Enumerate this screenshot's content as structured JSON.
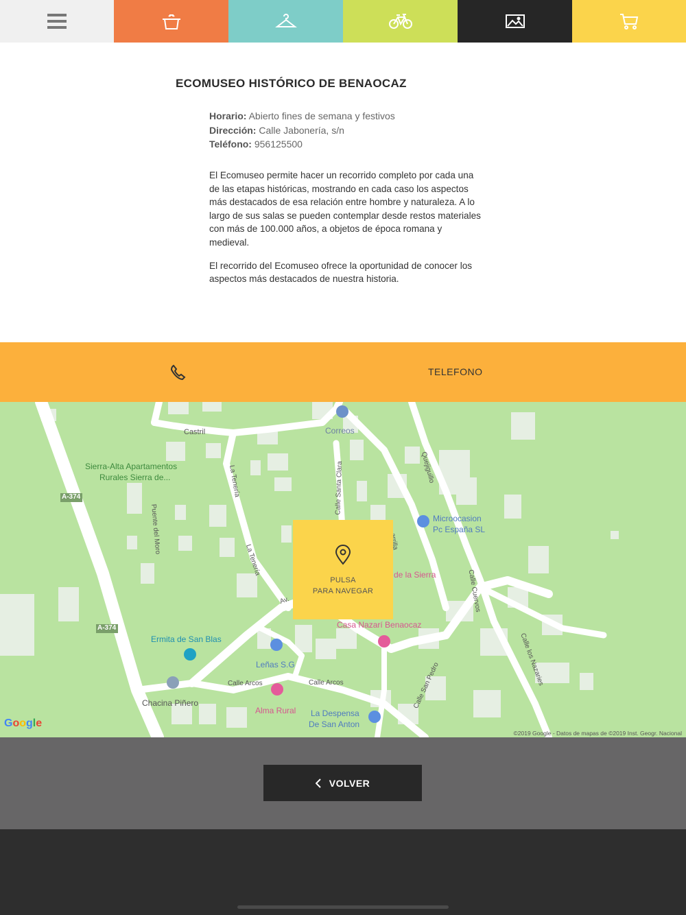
{
  "tabs": [
    {
      "name": "menu-icon",
      "color": "#f0f0f0"
    },
    {
      "name": "cooking-pot-icon",
      "color": "#f07c45"
    },
    {
      "name": "hanger-icon",
      "color": "#7ecdc8"
    },
    {
      "name": "bicycle-icon",
      "color": "#cddf58"
    },
    {
      "name": "image-icon",
      "color": "#262626"
    },
    {
      "name": "cart-icon",
      "color": "#fbd44b"
    }
  ],
  "place": {
    "title": "ECOMUSEO HISTÓRICO DE BENAOCAZ",
    "horario_label": "Horario:",
    "horario": "Abierto fines de semana y festivos",
    "direccion_label": "Dirección:",
    "direccion": "Calle Jabonería, s/n",
    "telefono_label": "Teléfono:",
    "telefono": "956125500",
    "description": [
      "El Ecomuseo permite hacer un recorrido completo por cada una de las etapas históricas, mostrando en cada caso los aspectos más destacados de esa relación entre hombre y naturaleza. A lo largo de sus salas se pueden contemplar desde restos materiales con más de 100.000 años, a objetos de época romana y medieval.",
      "El recorrido del Ecomuseo ofrece la oportunidad de conocer los aspectos más destacados de nuestra historia."
    ]
  },
  "phone_bar": {
    "icon": "phone-icon",
    "label": "TELEFONO",
    "color": "#fcb03c"
  },
  "map": {
    "labels": {
      "castril": "Castril",
      "correos": "Correos",
      "sierra_alta_1": "Sierra-Alta Apartamentos",
      "sierra_alta_2": "Rurales Sierra de...",
      "a374_1": "A-374",
      "a374_2": "A-374",
      "la_teneria_1": "La Tenería",
      "la_teneria_2": "La Tenería",
      "puente_moro": "Puente del Moro",
      "calle_santa_clara": "Calle Santa Clara",
      "quejiguillo": "Quejiguillo",
      "microocasion_1": "Microocasion",
      "microocasion_2": "Pc España SL",
      "de_la_sierra": "de la Sierra",
      "calle_cuervos": "Calle Cuervos",
      "barrilla": "arrilla",
      "casa_nazari": "Casa Nazarí Benaocaz",
      "calle_nazaries": "Calle los Nazaries",
      "av": "Av.",
      "ermita": "Ermita de San Blas",
      "lenas": "Leñas S.G",
      "calle_arcos_1": "Calle Arcos",
      "calle_arcos_2": "Calle Arcos",
      "calle_san_pedro": "Calle San Pedro",
      "chacina": "Chacina Piñero",
      "alma_rural": "Alma Rural",
      "despensa_1": "La Despensa",
      "despensa_2": "De San Anton"
    },
    "navigate_line1": "PULSA",
    "navigate_line2": "PARA NAVEGAR",
    "google": "Google",
    "copyright": "©2019 Google - Datos de mapas de ©2019 Inst. Geogr. Nacional"
  },
  "back_button": {
    "label": "VOLVER"
  }
}
